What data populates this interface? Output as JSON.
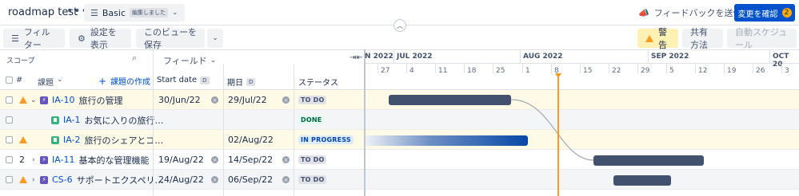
{
  "header": {
    "title": "roadmap test",
    "more_icon": "more-icon",
    "view_name": "Basic",
    "view_badge": "編集しました",
    "feedback_label": "フィードバックを送信",
    "review_label": "変更を確認",
    "review_count": "2",
    "colors": {
      "primary": "#0052cc",
      "warning_bg": "#fff0b3"
    }
  },
  "toolbar": {
    "filter_label": "フィルター",
    "display_label": "設定を表示",
    "save_view_label": "このビューを保存",
    "warning_label": "警告",
    "share_label": "共有方法",
    "auto_schedule_label": "自動スケジュール"
  },
  "left": {
    "scope_label": "スコープ",
    "field_label": "フィールド",
    "col_num": "#",
    "col_issue": "課題",
    "create_issue": "課題の作成",
    "col_start": "Start date",
    "col_start_badge": "D",
    "col_due": "期日",
    "col_due_badge": "D",
    "col_status": "ステータス"
  },
  "rows": [
    {
      "num": "",
      "key": "IA-10",
      "title": "旅行の管理",
      "start": "30/Jun/22",
      "due": "29/Jul/22",
      "status": "TO DO"
    },
    {
      "num": "",
      "key": "IA-1",
      "title": "お気に入りの旅行…",
      "start": "",
      "due": "",
      "status": "DONE"
    },
    {
      "num": "",
      "key": "IA-2",
      "title": "旅行のシェアとコ…",
      "start": "",
      "due": "02/Aug/22",
      "status": "IN PROGRESS"
    },
    {
      "num": "2",
      "key": "IA-11",
      "title": "基本的な管理機能",
      "start": "19/Aug/22",
      "due": "14/Sep/22",
      "status": "TO DO"
    },
    {
      "num": "",
      "key": "CS-6",
      "title": "サポートエクスペリ…",
      "start": "24/Aug/22",
      "due": "06/Sep/22",
      "status": "TO DO"
    }
  ],
  "timeline": {
    "months": [
      "N 2022",
      "JUL 2022",
      "AUG 2022",
      "SEP 2022",
      "OCT 20"
    ],
    "days": [
      "27",
      "4",
      "11",
      "18",
      "25",
      "1",
      "8",
      "15",
      "22",
      "29",
      "5",
      "12",
      "19",
      "26",
      "3"
    ]
  }
}
